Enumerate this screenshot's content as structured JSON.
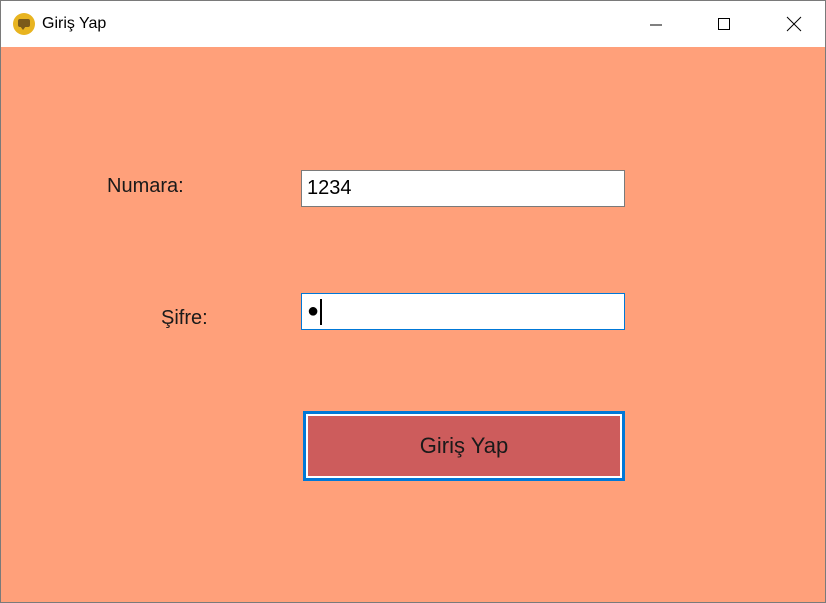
{
  "window": {
    "title": "Giriş Yap",
    "icon": "chat-bubble-icon",
    "controls": [
      "minimize-icon",
      "maximize-icon",
      "close-icon"
    ]
  },
  "form": {
    "background_color": "#ffa07a",
    "numara": {
      "label": "Numara:",
      "value": "1234"
    },
    "sifre": {
      "label": "Şifre:",
      "masked_value": "●",
      "focused": true
    },
    "submit": {
      "label": "Giriş Yap",
      "color": "#cd5c5c"
    }
  }
}
